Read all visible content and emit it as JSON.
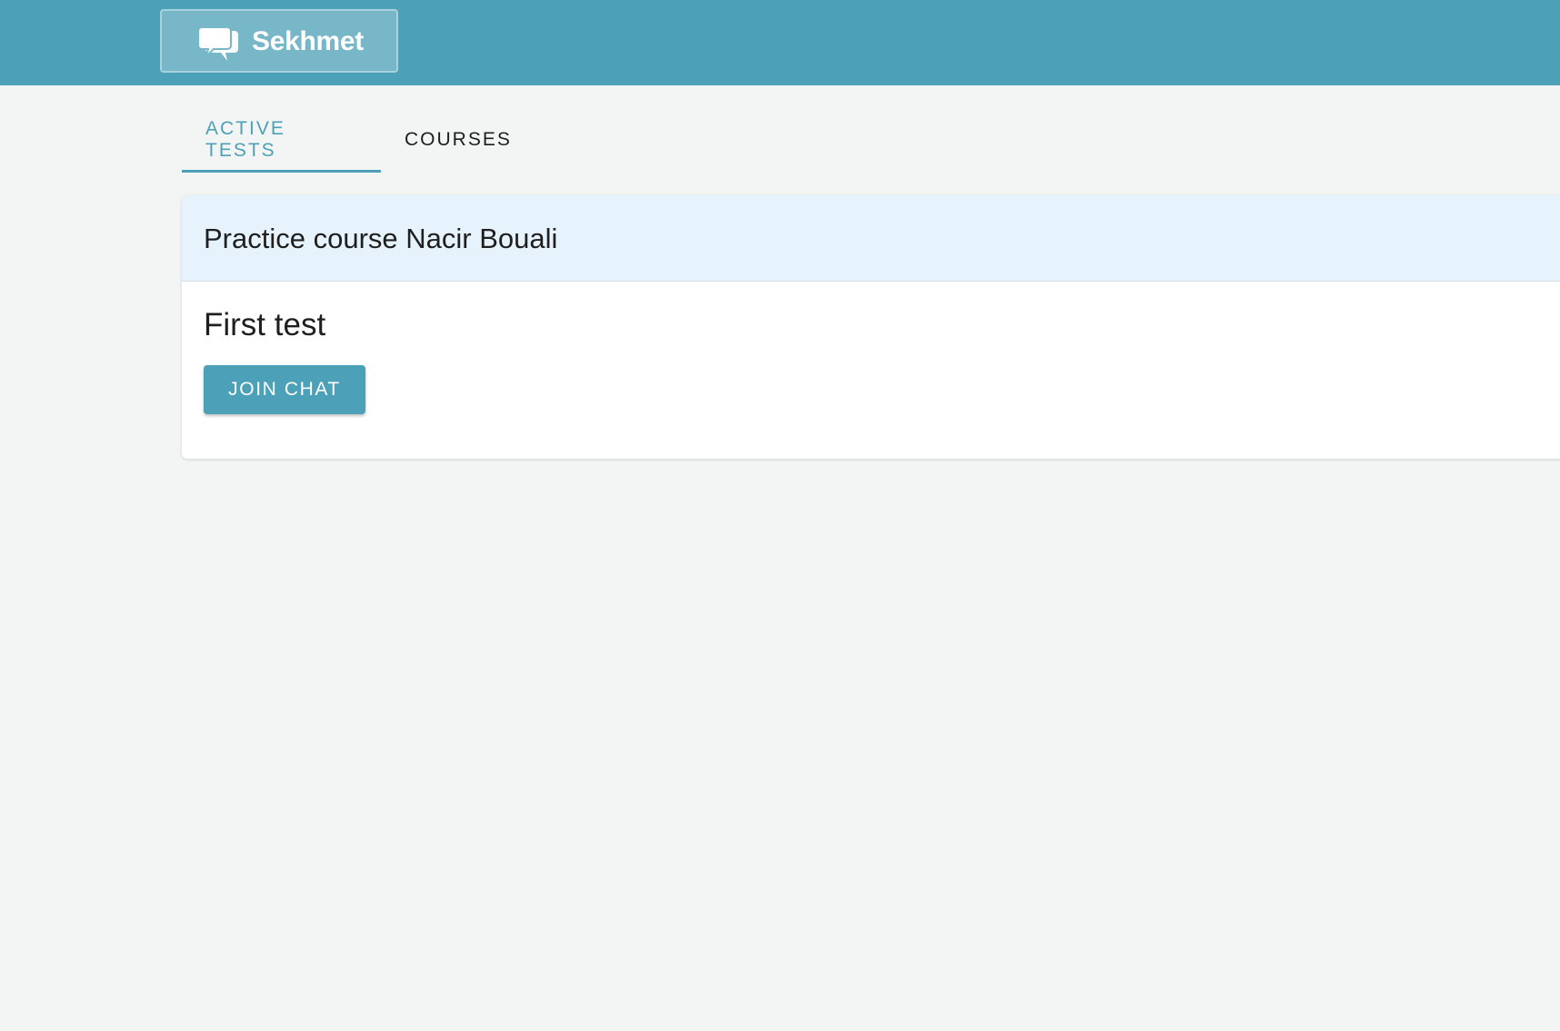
{
  "header": {
    "brand_name": "Sekhmet",
    "brand_icon": "chat-bubble-icon",
    "colors": {
      "bar": "#4ca1b8",
      "brand_box": "#77b7c8",
      "brand_border": "#a9d2de"
    }
  },
  "tabs": [
    {
      "label": "ACTIVE TESTS",
      "active": true
    },
    {
      "label": "COURSES",
      "active": false
    }
  ],
  "course_card": {
    "course_title": "Practice course Nacir Bouali",
    "test_title": "First test",
    "join_button_label": "JOIN CHAT",
    "colors": {
      "header_bg": "#e6f3fc",
      "button_bg": "#4ca1b8"
    }
  }
}
